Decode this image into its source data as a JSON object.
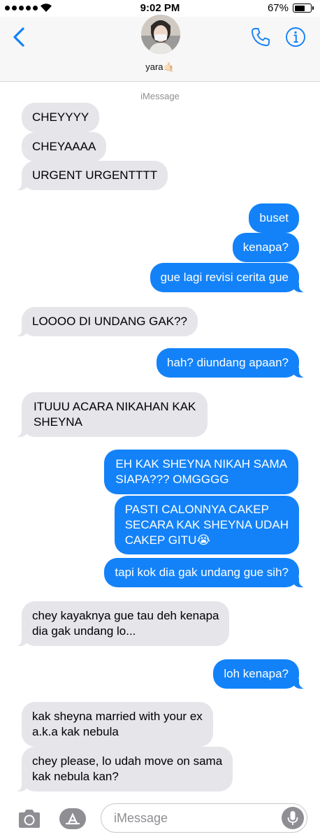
{
  "status_bar": {
    "time": "9:02 PM",
    "battery_percent": "67%",
    "battery_level": 0.67,
    "signal_bars": 5
  },
  "header": {
    "contact_name": "yara🤙🏻",
    "back_icon": "chevron-left-icon",
    "call_icon": "phone-icon",
    "info_icon": "info-icon",
    "accent_color": "#1382f8"
  },
  "conversation": {
    "service_label": "iMessage",
    "messages": [
      {
        "side": "in",
        "text": "CHEYYYY"
      },
      {
        "side": "in",
        "text": "CHEYAAAA"
      },
      {
        "side": "in",
        "text": "URGENT URGENTTTT"
      },
      {
        "side": "out",
        "text": "buset"
      },
      {
        "side": "out",
        "text": "kenapa?"
      },
      {
        "side": "out",
        "text": "gue lagi revisi cerita gue"
      },
      {
        "side": "in",
        "text": "LOOOO DI UNDANG GAK??"
      },
      {
        "side": "out",
        "text": "hah? diundang apaan?"
      },
      {
        "side": "in",
        "text": "ITUUU ACARA NIKAHAN KAK\nSHEYNA"
      },
      {
        "side": "out",
        "text": "EH KAK SHEYNA NIKAH SAMA\nSIAPA??? OMGGGG"
      },
      {
        "side": "out",
        "text": "PASTI CALONNYA CAKEP\nSECARA KAK SHEYNA UDAH\nCAKEP GITU😭"
      },
      {
        "side": "out",
        "text": "tapi kok dia gak undang gue sih?"
      },
      {
        "side": "in",
        "text": "chey kayaknya gue tau deh kenapa\ndia gak undang lo..."
      },
      {
        "side": "out",
        "text": "loh kenapa?"
      },
      {
        "side": "in",
        "text": "kak sheyna married with your ex\na.k.a kak nebula"
      },
      {
        "side": "in",
        "text": "chey please, lo udah move on sama\nkak nebula kan?"
      }
    ],
    "incoming_color": "#e5e5ea",
    "outgoing_color": "#1382f8"
  },
  "input_bar": {
    "placeholder": "iMessage",
    "camera_icon": "camera-icon",
    "apps_icon": "app-store-icon",
    "mic_icon": "microphone-icon"
  }
}
